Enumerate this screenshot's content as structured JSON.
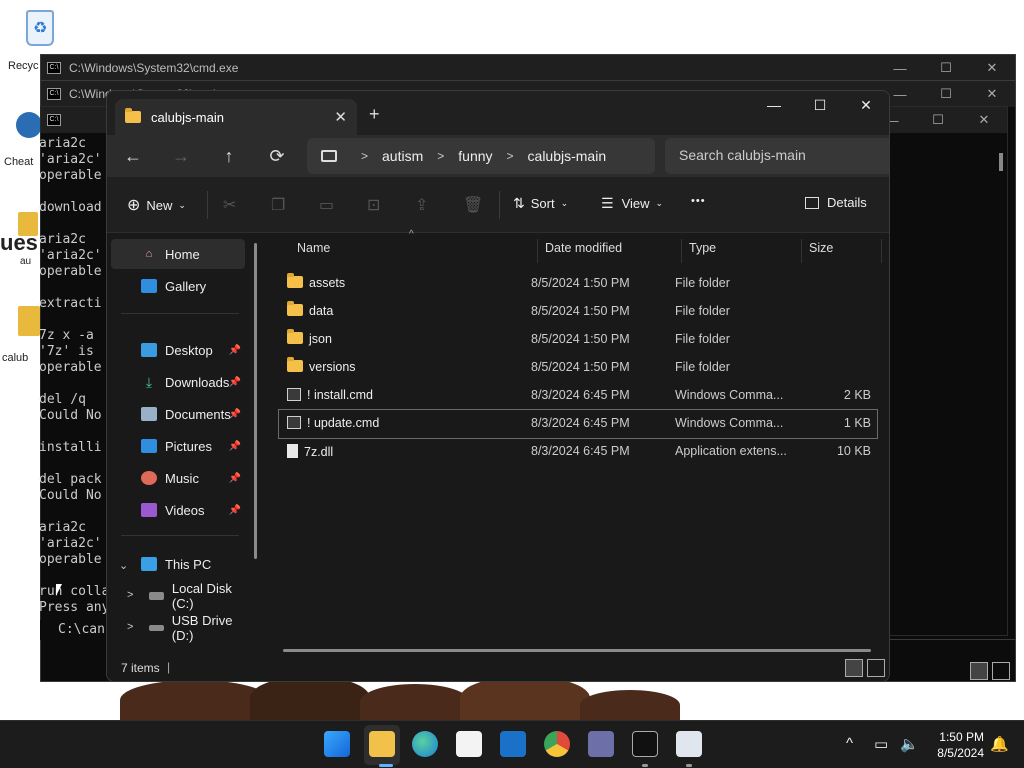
{
  "desktop": {
    "icons": [
      "Recyc",
      "Cheat",
      "ues",
      "au",
      "calub"
    ]
  },
  "cmd_windows": [
    {
      "title": "C:\\Windows\\System32\\cmd.exe"
    },
    {
      "title": "C:\\Windows\\System32\\cmd.exe"
    },
    {
      "title": ""
    }
  ],
  "cmd_text": "aria2c \n'aria2c' \noperable\n\ndownload\n\naria2c \n'aria2c' \noperable\n\nextracti\n\n7z x -a\n'7z' is \noperable\n\ndel /q \nCould No\n\ninstalli\n\ndel pack\nCould No\n\naria2c \n'aria2c' \noperable\n\nrun colla\nPress any",
  "cmd_prompt": "C:\\can",
  "explorer": {
    "tab_title": "calubjs-main",
    "tab_close": "✕",
    "new_tab": "+",
    "window_controls": {
      "minimize": "—",
      "maximize": "☐",
      "close": "✕"
    },
    "nav": {
      "back": "←",
      "forward": "→",
      "up": "↑",
      "refresh": "⟳"
    },
    "breadcrumbs": [
      "autism",
      "funny",
      "calubjs-main"
    ],
    "search_placeholder": "Search calubjs-main",
    "toolbar": {
      "new_label": "New",
      "sort_label": "Sort",
      "view_label": "View",
      "more_label": "•••",
      "details_label": "Details"
    },
    "sidebar": {
      "top": [
        {
          "label": "Home",
          "icon": "home-icon"
        },
        {
          "label": "Gallery",
          "icon": "gallery-icon"
        }
      ],
      "quick": [
        {
          "label": "Desktop",
          "icon": "desktop-icon"
        },
        {
          "label": "Downloads",
          "icon": "downloads-icon"
        },
        {
          "label": "Documents",
          "icon": "documents-icon"
        },
        {
          "label": "Pictures",
          "icon": "pictures-icon"
        },
        {
          "label": "Music",
          "icon": "music-icon"
        },
        {
          "label": "Videos",
          "icon": "videos-icon"
        }
      ],
      "this_pc": "This PC",
      "drives": [
        "Local Disk (C:)",
        "USB Drive (D:)"
      ]
    },
    "columns": {
      "name": "Name",
      "date": "Date modified",
      "type": "Type",
      "size": "Size"
    },
    "files": [
      {
        "name": "assets",
        "date": "8/5/2024 1:50 PM",
        "type": "File folder",
        "size": "",
        "kind": "folder"
      },
      {
        "name": "data",
        "date": "8/5/2024 1:50 PM",
        "type": "File folder",
        "size": "",
        "kind": "folder"
      },
      {
        "name": "json",
        "date": "8/5/2024 1:50 PM",
        "type": "File folder",
        "size": "",
        "kind": "folder"
      },
      {
        "name": "versions",
        "date": "8/5/2024 1:50 PM",
        "type": "File folder",
        "size": "",
        "kind": "folder"
      },
      {
        "name": "! install.cmd",
        "date": "8/3/2024 6:45 PM",
        "type": "Windows Comma...",
        "size": "2 KB",
        "kind": "cmd"
      },
      {
        "name": "! update.cmd",
        "date": "8/3/2024 6:45 PM",
        "type": "Windows Comma...",
        "size": "1 KB",
        "kind": "cmd"
      },
      {
        "name": "7z.dll",
        "date": "8/3/2024 6:45 PM",
        "type": "Application extens...",
        "size": "10 KB",
        "kind": "dll"
      }
    ],
    "status": "7 items"
  },
  "taskbar": {
    "apps": [
      "start-icon",
      "file-explorer-icon",
      "edge-icon",
      "store-icon",
      "outlook-icon",
      "chrome-icon",
      "game-icon",
      "terminal-icon",
      "notepad-icon"
    ],
    "time": "1:50 PM",
    "date": "8/5/2024",
    "tray_chevron": "^"
  },
  "colors": {
    "folder": "#f5c04a",
    "explorer_bg": "#191919",
    "taskbar_bg": "#1c1c1c"
  }
}
